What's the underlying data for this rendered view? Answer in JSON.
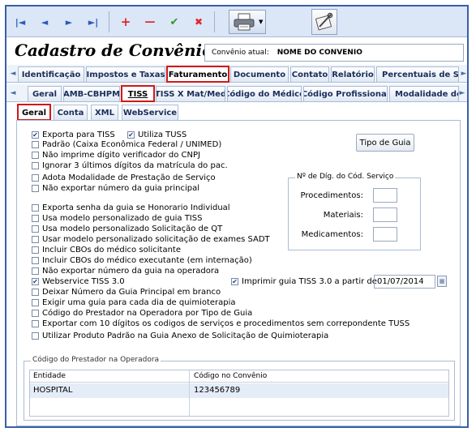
{
  "toolbar": {
    "buttons": [
      {
        "name": "first-record-icon",
        "glyph": "|◄",
        "color": "#2a5bb8"
      },
      {
        "name": "previous-record-icon",
        "glyph": "◄",
        "color": "#2a5bb8"
      },
      {
        "name": "next-record-icon",
        "glyph": "►",
        "color": "#2a5bb8"
      },
      {
        "name": "last-record-icon",
        "glyph": "►|",
        "color": "#2a5bb8"
      },
      {
        "name": "add-record-icon",
        "glyph": "+",
        "color": "#e0262a"
      },
      {
        "name": "remove-record-icon",
        "glyph": "—",
        "color": "#e0262a"
      },
      {
        "name": "confirm-icon",
        "glyph": "✔",
        "color": "#2a9a2a"
      },
      {
        "name": "cancel-icon",
        "glyph": "✖",
        "color": "#e0262a"
      }
    ]
  },
  "header": {
    "title": "Cadastro de Convênios",
    "current_label": "Convênio atual:",
    "current_value": "NOME DO CONVENIO"
  },
  "main_tabs": [
    "Identificação",
    "Impostos e Taxas",
    "Faturamento",
    "Documento",
    "Contato",
    "Relatório",
    "Percentuais de Serv"
  ],
  "sub_tabs": [
    "Geral",
    "AMB-CBHPM",
    "TISS",
    "TISS X Mat/Med",
    "Código do Médico",
    "Código Profissional",
    "Modalidade de"
  ],
  "tiss_tabs": [
    "Geral",
    "Conta",
    "XML",
    "WebService"
  ],
  "options": {
    "exporta_tiss": "Exporta para TISS",
    "utiliza_tuss": "Utiliza TUSS",
    "padrao": "Padrão (Caixa Econômica Federal / UNIMED)",
    "nao_imprime": "Não imprime dígito verificador do CNPJ",
    "ignorar": "Ignorar 3 últimos dígitos da matrícula do pac.",
    "adota": "Adota Modalidade de Prestação de Serviço",
    "nao_exportar_principal": "Não exportar número da guia principal",
    "exporta_senha": "Exporta senha da guia se Honorario Individual",
    "modelo_tiss": "Usa modelo personalizado de guia TISS",
    "modelo_qt": "Usa modelo personalizado Solicitação de QT",
    "modelo_sadt": "Usar modelo personalizado solicitação de exames SADT",
    "cbo_solicitante": "Incluir CBOs do médico solicitante",
    "cbo_executante": "Incluir CBOs do médico executante (em internação)",
    "nao_exportar_operadora": "Não exportar número da guia na operadora",
    "webservice": "Webservice TISS 3.0",
    "imprimir_tiss": "Imprimir guia TISS 3.0 a partir de",
    "deixar_numero": "Deixar Número da Guia Principal em branco",
    "exigir": "Exigir uma guia para cada dia de quimioterapia",
    "codigo_prestador": "Código do Prestador na Operadora por Tipo de Guia",
    "exportar_10": "Exportar com 10 dígitos os codigos de serviços e procedimentos sem correpondente TUSS",
    "utilizar_produto": "Utilizar Produto Padrão na Guia Anexo de Solicitação de Quimioterapia"
  },
  "tipo_guia_button": "Tipo de Guia",
  "digit_group": {
    "title": "Nº de Díg. do Cód. Serviço",
    "procedimentos": "Procedimentos:",
    "materiais": "Materiais:",
    "medicamentos": "Medicamentos:"
  },
  "imprimir_date": "01/07/2014",
  "prestador_group": {
    "title": "Código do Prestador na Operadora",
    "columns": [
      "Entidade",
      "Código no Convênio"
    ],
    "rows": [
      {
        "entidade": "HOSPITAL",
        "codigo": "123456789"
      }
    ]
  }
}
